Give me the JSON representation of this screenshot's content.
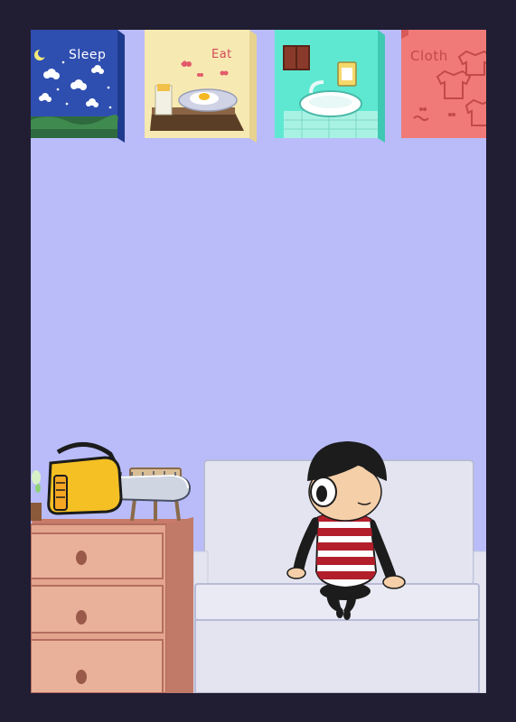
{
  "activities": [
    {
      "key": "sleep",
      "label": "Sleep",
      "color": "#2f4fb0"
    },
    {
      "key": "eat",
      "label": "Eat",
      "color": "#f7e9b2"
    },
    {
      "key": "wash",
      "label": "",
      "color": "#5ee8d2"
    },
    {
      "key": "clothes",
      "label": "Cloth",
      "color": "#f07a78"
    }
  ],
  "colors": {
    "frame": "#211d33",
    "wall": "#b9bcf9",
    "sofa": "#e3e4ef",
    "dresser": "#e4a58e",
    "chainsaw": "#f5c023",
    "shirt_red": "#b21e2a"
  },
  "props": {
    "chainsaw": "chainsaw-icon",
    "character": "character-sprite"
  }
}
